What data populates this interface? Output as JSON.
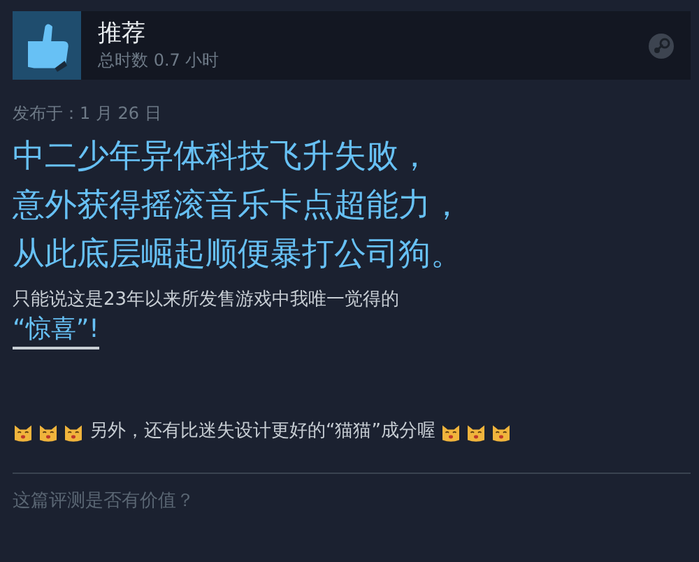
{
  "review": {
    "verdict": "推荐",
    "recommended": true,
    "playtime": "总时数 0.7 小时"
  },
  "posted": "发布于：1 月 26 日",
  "body": [
    {
      "kind": "headline",
      "text": "中二少年异体科技飞升失败，"
    },
    {
      "kind": "headline",
      "text": "意外获得摇滚音乐卡点超能力，"
    },
    {
      "kind": "headline",
      "text": "从此底层崛起顺便暴打公司狗。"
    },
    {
      "kind": "text",
      "text": "只能说这是23年以来所发售游戏中我唯一觉得的"
    },
    {
      "kind": "link",
      "text": "“惊喜”!"
    },
    {
      "kind": "cats",
      "text": "另外，还有比迷失设计更好的“猫猫”成分喔"
    }
  ],
  "footer": "这篇评测是否有价值？"
}
